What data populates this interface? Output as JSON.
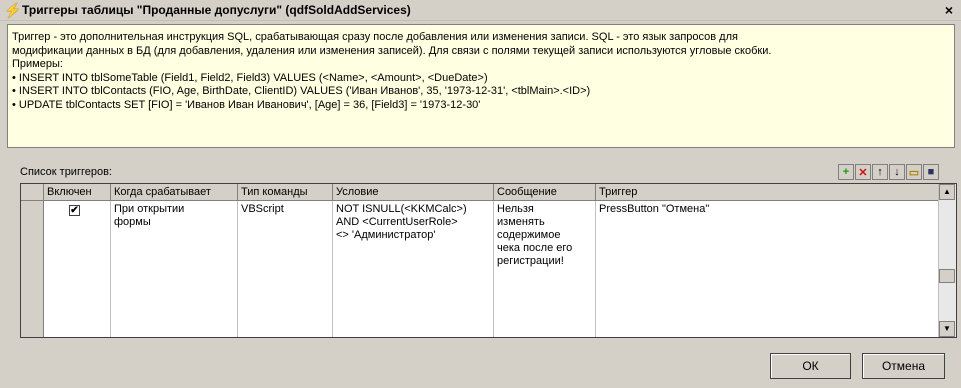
{
  "window": {
    "title": "Триггеры таблицы \"Проданные допуслуги\" (qdfSoldAddServices)",
    "close_glyph": "×"
  },
  "info": {
    "lines": [
      "Триггер - это дополнительная инструкция SQL, срабатывающая сразу после добавления или изменения записи. SQL - это язык запросов для",
      "модификации данных в БД (для добавления, удаления или изменения записей). Для связи с полями текущей записи используются угловые скобки.",
      "Примеры:",
      "• INSERT INTO tblSomeTable (Field1, Field2, Field3) VALUES (<Name>, <Amount>, <DueDate>)",
      "• INSERT INTO tblContacts (FIO, Age, BirthDate, ClientID) VALUES ('Иван Иванов', 35, '1973-12-31', <tblMain>.<ID>)",
      "• UPDATE tblContacts SET [FIO] = 'Иванов Иван Иванович', [Age] = 36, [Field3] = '1973-12-30'"
    ]
  },
  "list_label": "Список триггеров:",
  "toolbar": {
    "add": "+",
    "delete": "✕",
    "up": "↑",
    "down": "↓",
    "open": "▭",
    "save": "■"
  },
  "grid": {
    "headers": [
      "Включен",
      "Когда срабатывает",
      "Тип команды",
      "Условие",
      "Сообщение",
      "Триггер"
    ],
    "row": {
      "checked_glyph": "✔",
      "when_lines": [
        "При открытии",
        "формы"
      ],
      "type": "VBScript",
      "condition_lines": [
        "NOT ISNULL(<KKMCalc>)",
        "AND <CurrentUserRole>",
        "<> 'Администратор'"
      ],
      "message_lines": [
        "Нельзя",
        "изменять",
        "содержимое",
        "чека после его",
        "регистрации!"
      ],
      "trigger": "PressButton \"Отмена\""
    }
  },
  "buttons": {
    "ok": "ОК",
    "cancel": "Отмена"
  },
  "colors": {
    "info_bg": "#ffffe1",
    "dialog_bg": "#d4d0c8"
  }
}
